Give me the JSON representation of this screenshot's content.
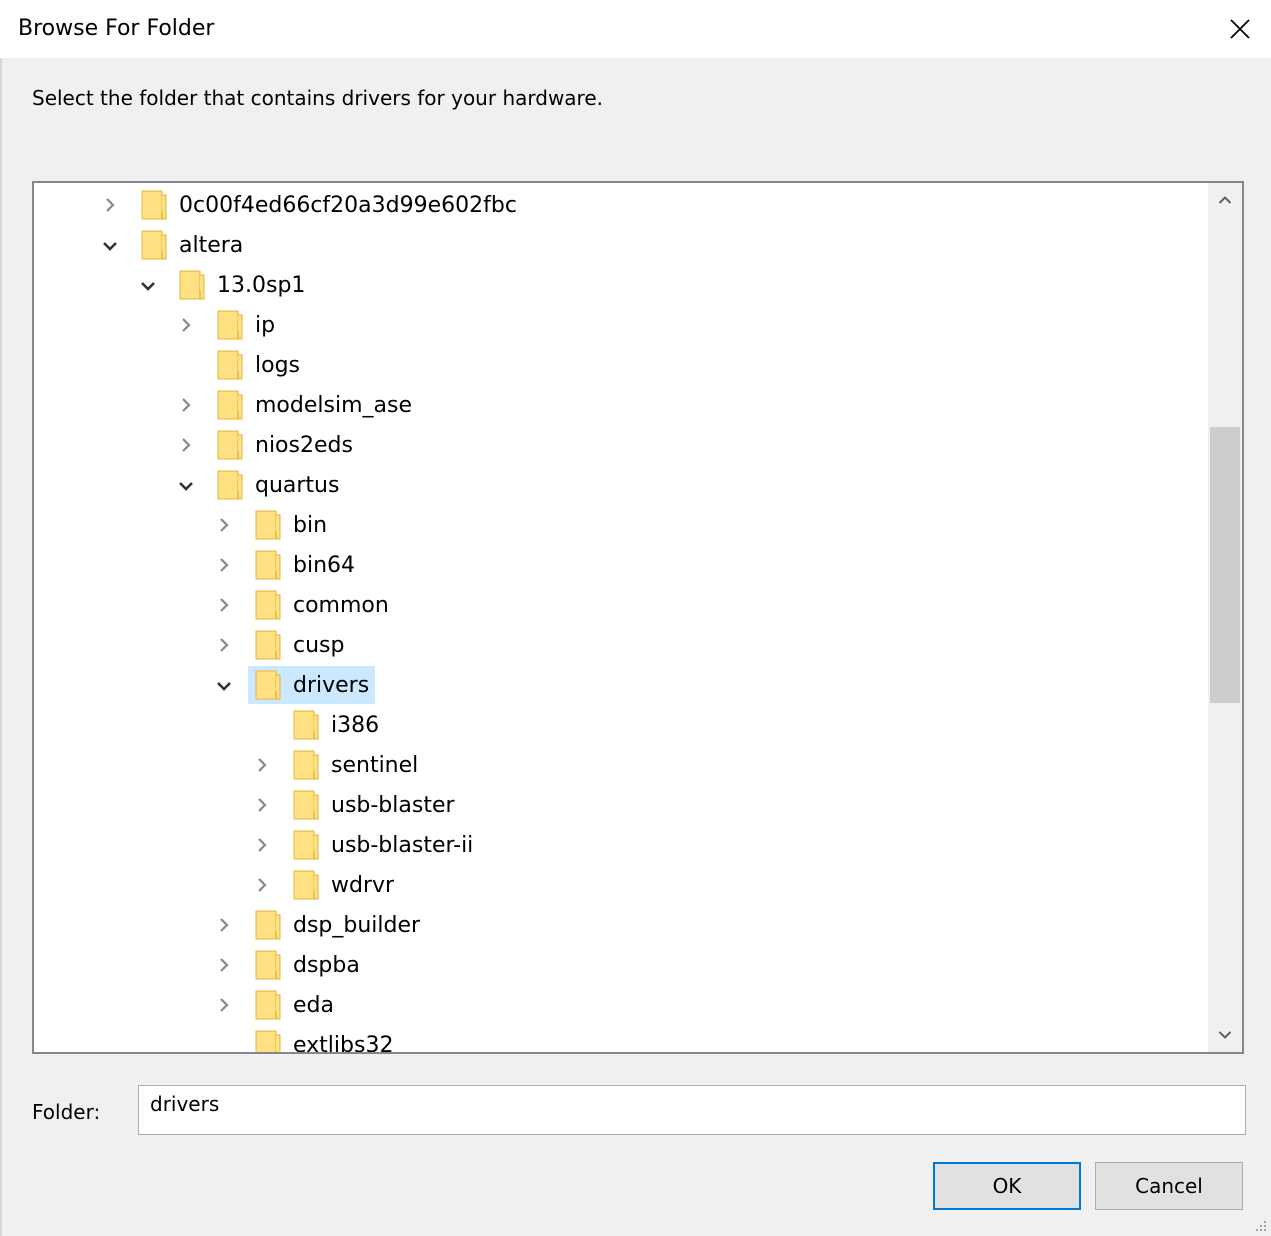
{
  "window": {
    "title": "Browse For Folder",
    "close_icon": "close-icon"
  },
  "dialog": {
    "instruction": "Select the folder that contains drivers for your hardware."
  },
  "colors": {
    "selection": "#cce8ff",
    "folder_fill": "#ffe083",
    "folder_edge": "#e0b53a",
    "default_button_border": "#0078d7"
  },
  "tree": {
    "items": [
      {
        "label": "0c00f4ed66cf20a3d99e602fbc",
        "depth": 0,
        "expander": "collapsed",
        "selected": false
      },
      {
        "label": "altera",
        "depth": 0,
        "expander": "expanded",
        "selected": false
      },
      {
        "label": "13.0sp1",
        "depth": 1,
        "expander": "expanded",
        "selected": false
      },
      {
        "label": "ip",
        "depth": 2,
        "expander": "collapsed",
        "selected": false
      },
      {
        "label": "logs",
        "depth": 2,
        "expander": "none",
        "selected": false
      },
      {
        "label": "modelsim_ase",
        "depth": 2,
        "expander": "collapsed",
        "selected": false
      },
      {
        "label": "nios2eds",
        "depth": 2,
        "expander": "collapsed",
        "selected": false
      },
      {
        "label": "quartus",
        "depth": 2,
        "expander": "expanded",
        "selected": false
      },
      {
        "label": "bin",
        "depth": 3,
        "expander": "collapsed",
        "selected": false
      },
      {
        "label": "bin64",
        "depth": 3,
        "expander": "collapsed",
        "selected": false
      },
      {
        "label": "common",
        "depth": 3,
        "expander": "collapsed",
        "selected": false
      },
      {
        "label": "cusp",
        "depth": 3,
        "expander": "collapsed",
        "selected": false
      },
      {
        "label": "drivers",
        "depth": 3,
        "expander": "expanded",
        "selected": true
      },
      {
        "label": "i386",
        "depth": 4,
        "expander": "none",
        "selected": false
      },
      {
        "label": "sentinel",
        "depth": 4,
        "expander": "collapsed",
        "selected": false
      },
      {
        "label": "usb-blaster",
        "depth": 4,
        "expander": "collapsed",
        "selected": false
      },
      {
        "label": "usb-blaster-ii",
        "depth": 4,
        "expander": "collapsed",
        "selected": false
      },
      {
        "label": "wdrvr",
        "depth": 4,
        "expander": "collapsed",
        "selected": false
      },
      {
        "label": "dsp_builder",
        "depth": 3,
        "expander": "collapsed",
        "selected": false
      },
      {
        "label": "dspba",
        "depth": 3,
        "expander": "collapsed",
        "selected": false
      },
      {
        "label": "eda",
        "depth": 3,
        "expander": "collapsed",
        "selected": false
      },
      {
        "label": "extlibs32",
        "depth": 3,
        "expander": "none",
        "selected": false
      }
    ]
  },
  "folder_field": {
    "label": "Folder:",
    "value": "drivers"
  },
  "buttons": {
    "ok": "OK",
    "cancel": "Cancel"
  }
}
